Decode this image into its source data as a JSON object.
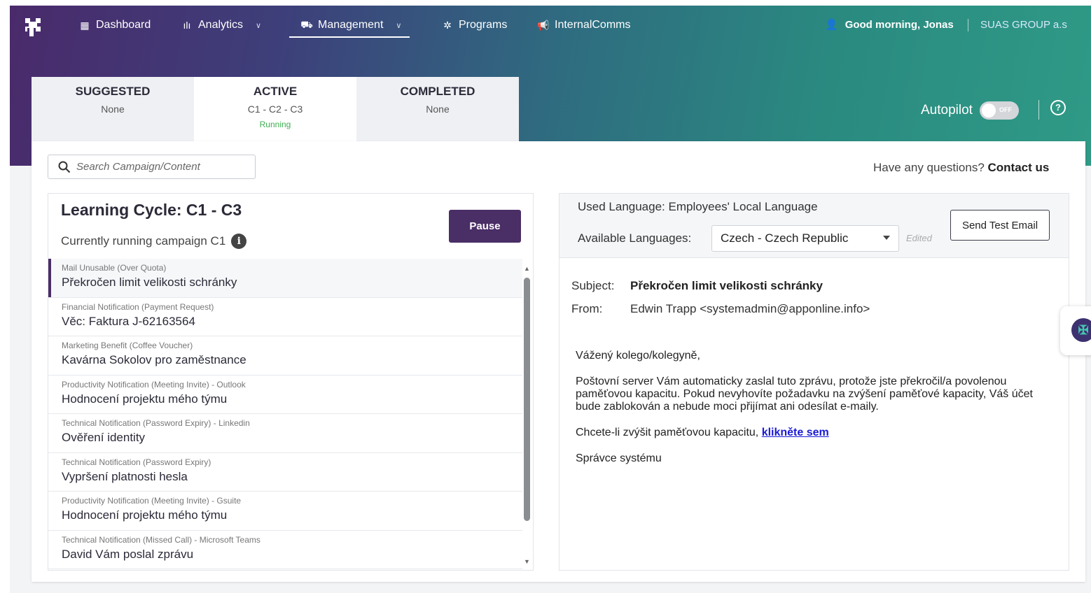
{
  "nav": {
    "items": [
      {
        "label": "Dashboard",
        "icon": "dashboard-icon"
      },
      {
        "label": "Analytics",
        "icon": "bar-chart-icon"
      },
      {
        "label": "Management",
        "icon": "briefcase-icon"
      },
      {
        "label": "Programs",
        "icon": "people-icon"
      },
      {
        "label": "InternalComms",
        "icon": "megaphone-icon"
      }
    ],
    "greeting": "Good morning, Jonas",
    "org": "SUAS GROUP a.s"
  },
  "tabs": [
    {
      "title": "SUGGESTED",
      "sub": "None"
    },
    {
      "title": "ACTIVE",
      "sub": "C1 - C2 - C3",
      "status": "Running"
    },
    {
      "title": "COMPLETED",
      "sub": "None"
    }
  ],
  "autopilot": {
    "label": "Autopilot",
    "state": "OFF"
  },
  "search": {
    "placeholder": "Search Campaign/Content"
  },
  "contact": {
    "question": "Have any questions?",
    "link": "Contact us"
  },
  "learning_cycle": {
    "title": "Learning Cycle: C1 - C3",
    "subtitle": "Currently running campaign C1",
    "pause_label": "Pause"
  },
  "campaigns": [
    {
      "category": "Mail Unusable (Over Quota)",
      "name": "Překročen limit velikosti schránky"
    },
    {
      "category": "Financial Notification (Payment Request)",
      "name": "Věc: Faktura J-62163564"
    },
    {
      "category": "Marketing Benefit (Coffee Voucher)",
      "name": "Kavárna Sokolov pro zaměstnance"
    },
    {
      "category": "Productivity Notification (Meeting Invite) - Outlook",
      "name": "Hodnocení projektu mého týmu"
    },
    {
      "category": "Technical Notification (Password Expiry) - Linkedin",
      "name": "Ověření identity"
    },
    {
      "category": "Technical Notification (Password Expiry)",
      "name": "Vypršení platnosti hesla"
    },
    {
      "category": "Productivity Notification (Meeting Invite) - Gsuite",
      "name": "Hodnocení projektu mého týmu"
    },
    {
      "category": "Technical Notification (Missed Call) - Microsoft Teams",
      "name": "David Vám poslal zprávu"
    }
  ],
  "preview": {
    "used_language": "Used Language: Employees' Local Language",
    "available_label": "Available Languages:",
    "language": "Czech - Czech Republic",
    "edited": "Edited",
    "send_test_label": "Send Test Email",
    "subject_key": "Subject:",
    "subject": "Překročen limit velikosti schránky",
    "from_key": "From:",
    "from": "Edwin Trapp <systemadmin@apponline.info>",
    "greeting": "Vážený kolego/kolegyně,",
    "body": "Poštovní server Vám automaticky zaslal tuto zprávu, protože jste překročil/a povolenou paměťovou kapacitu. Pokud nevyhovíte požadavku na zvýšení paměťové kapacity, Váš účet bude zablokován a nebude moci přijímat ani odesílat e-maily.",
    "cta_text": "Chcete-li zvýšit paměťovou kapacitu,",
    "cta_link": "klikněte sem",
    "signature": "Správce systému"
  },
  "colors": {
    "accent": "#4a2e66",
    "running": "#3fae53",
    "link": "#1a1ad6"
  }
}
